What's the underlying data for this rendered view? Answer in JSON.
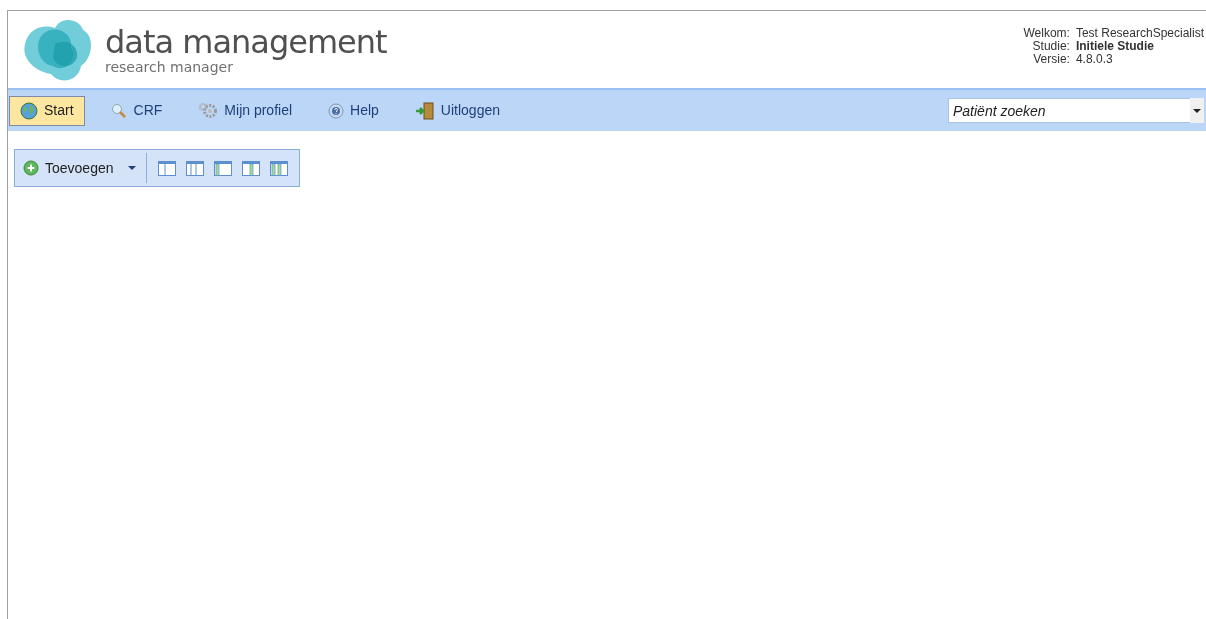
{
  "logo": {
    "title": "data management",
    "subtitle": "research manager"
  },
  "user_info": [
    {
      "label": "Welkom:",
      "value": "Test ResearchSpecialist",
      "bold": false
    },
    {
      "label": "Studie:",
      "value": "Initiele Studie",
      "bold": true
    },
    {
      "label": "Versie:",
      "value": "4.8.0.3",
      "bold": false
    }
  ],
  "nav": [
    {
      "kind": "globe",
      "label": "Start",
      "selected": true
    },
    {
      "kind": "search",
      "label": "CRF",
      "selected": false
    },
    {
      "kind": "gear",
      "label": "Mijn profiel",
      "selected": false
    },
    {
      "kind": "help",
      "label": "Help",
      "selected": false
    },
    {
      "kind": "exit",
      "label": "Uitloggen",
      "selected": false
    }
  ],
  "patient_search": {
    "placeholder": "Patiënt zoeken"
  },
  "toolbar": {
    "add_button": "Toevoegen",
    "layouts": [
      {
        "kind": "two"
      },
      {
        "kind": "three"
      },
      {
        "kind": "left"
      },
      {
        "kind": "right"
      },
      {
        "kind": "sides"
      }
    ]
  }
}
